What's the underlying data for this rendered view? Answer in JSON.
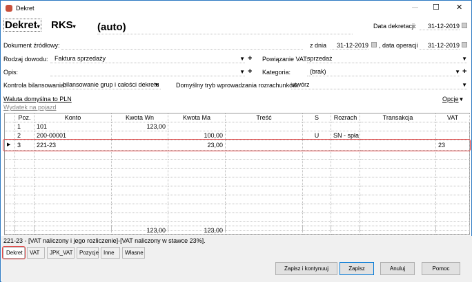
{
  "window": {
    "title": "Dekret",
    "minimize": "—",
    "maximize": "☐",
    "close": "✕"
  },
  "header": {
    "type": "Dekret",
    "register": "RKS",
    "number": "(auto)",
    "date_label": "Data dekretacji:",
    "date_value": "31-12-2019"
  },
  "form": {
    "source_doc_label": "Dokument źródłowy:",
    "z_dnia_label": "z dnia",
    "z_dnia_value": "31-12-2019",
    "op_date_label": ", data operacji",
    "op_date_value": "31-12-2019",
    "evidence_label": "Rodzaj dowodu:",
    "evidence_value": "Faktura sprzedaży",
    "vat_link_label": "Powiązanie VAT:",
    "vat_link_value": "sprzedaż",
    "desc_label": "Opis:",
    "desc_value": "",
    "category_label": "Kategoria:",
    "category_value": "(brak)",
    "balance_label": "Kontrola bilansowania:",
    "balance_value": "bilansowanie grup i całości dekretu",
    "settle_label": "Domyślny tryb wprowadzania rozrachunków:",
    "settle_value": "utwórz",
    "currency_link": "Waluta domyślna to PLN",
    "vehicle_link": "Wydatek na pojazd",
    "options": "Opcje"
  },
  "grid": {
    "columns": [
      "Poz.",
      "Konto",
      "Kwota Wn",
      "Kwota Ma",
      "Treść",
      "S",
      "Rozrach",
      "Transakcja",
      "VAT"
    ],
    "rows": [
      [
        "1",
        "101",
        "123,00",
        "",
        "",
        "",
        "",
        "",
        ""
      ],
      [
        "2",
        "200-00001",
        "",
        "100,00",
        "",
        "U",
        "SN - spła",
        "",
        ""
      ],
      [
        "3",
        "221-23",
        "",
        "23,00",
        "",
        "",
        "",
        "",
        "23"
      ]
    ],
    "totals": {
      "wn": "123,00",
      "ma": "123,00"
    }
  },
  "status": "221-23 - [VAT naliczony i jego rozliczenie]-[VAT naliczony w stawce 23%].",
  "tabs": [
    "Dekret",
    "VAT",
    "JPK_VAT",
    "Pozycje",
    "Inne",
    "Własne"
  ],
  "buttons": {
    "save_continue": "Zapisz i kontynuuj",
    "save": "Zapisz",
    "cancel": "Anuluj",
    "help": "Pomoc"
  }
}
